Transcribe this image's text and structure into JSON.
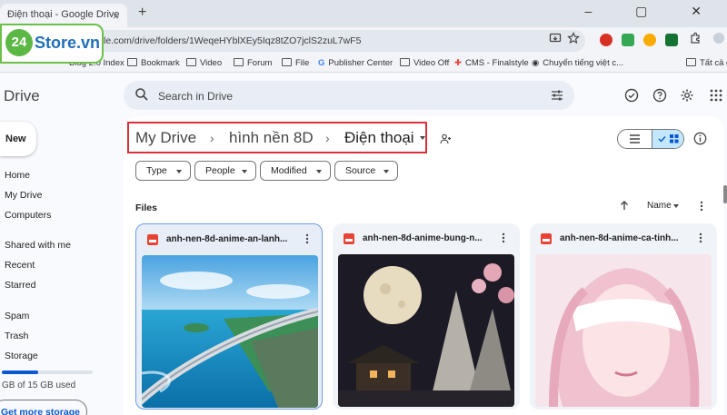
{
  "browser": {
    "tab_title": "Điện thoại - Google Drive",
    "tab_close": "×",
    "new_tab": "+",
    "window_controls": "–  ▢  ✕",
    "url": "le.com/drive/folders/1WeqeHYblXEy5Iqz8tZO7jclS2zuL7wF5",
    "bookmarks": [
      "Blog 2.0 Index",
      "Bookmark",
      "Video",
      "Forum",
      "File",
      "Publisher Center",
      "Video Off",
      "CMS - Finalstyle",
      "Chuyển tiếng việt c...",
      "Tất cả d"
    ]
  },
  "logo": {
    "badge": "24",
    "text": "Store.vn"
  },
  "drive": {
    "app_title": "Drive",
    "search_placeholder": "Search in Drive",
    "new_button": "New",
    "nav": [
      "Home",
      "My Drive",
      "Computers",
      "Shared with me",
      "Recent",
      "Starred",
      "Spam",
      "Trash",
      "Storage"
    ],
    "storage_used_fraction": 0.4,
    "storage_text": "GB of 15 GB used",
    "get_more_storage": "Get more storage"
  },
  "breadcrumb": [
    "My Drive",
    "hình nền 8D",
    "Điện thoại"
  ],
  "filters": [
    "Type",
    "People",
    "Modified",
    "Source"
  ],
  "files_label": "Files",
  "sort_label": "Name",
  "files": [
    {
      "name": "anh-nen-8d-anime-an-lanh..."
    },
    {
      "name": "anh-nen-8d-anime-bung-n..."
    },
    {
      "name": "anh-nen-8d-anime-ca-tinh..."
    }
  ],
  "colors": {
    "accent": "#0b57d0",
    "highlight_box": "#d9313a",
    "file_icon": "#e94235",
    "logo_green": "#5bb844"
  }
}
